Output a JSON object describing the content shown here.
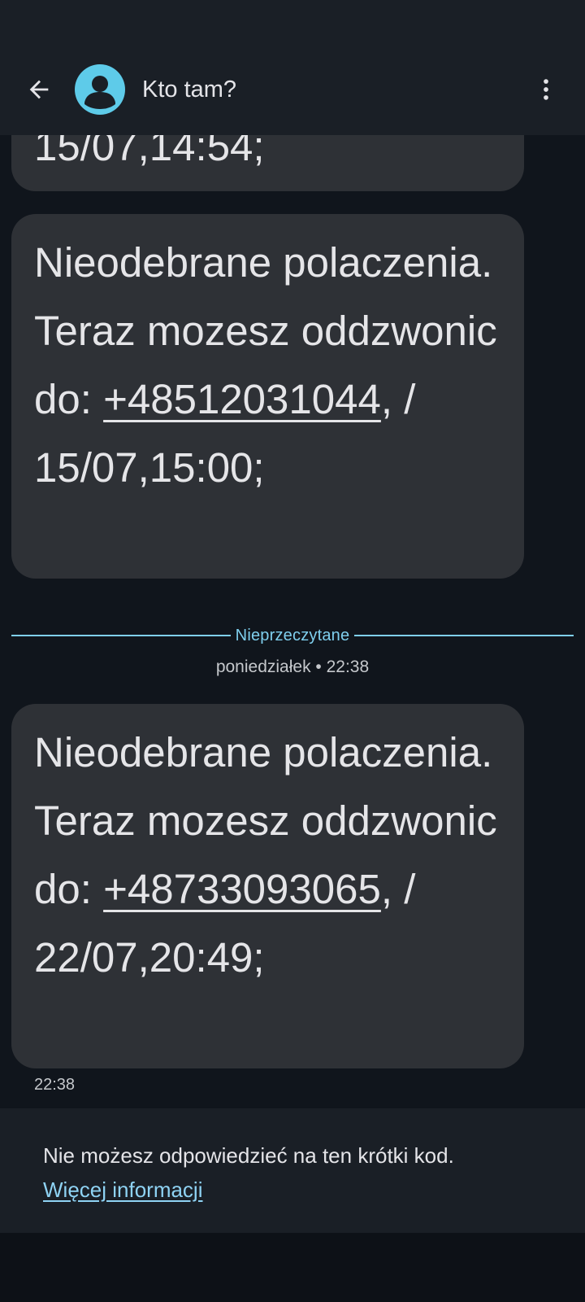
{
  "header": {
    "contact_name": "Kto tam?",
    "back_icon": "arrow-left-icon",
    "avatar_icon": "person-icon",
    "menu_icon": "more-vert-icon"
  },
  "messages": [
    {
      "lines_partial": "15/07,14:54;"
    },
    {
      "text_before": "Nieodebrane polaczenia. Teraz mozesz oddzwonic do: ",
      "phone": "+48512031044",
      "text_after": ", / 15/07,15:00;"
    },
    {
      "text_before": "Nieodebrane polaczenia. Teraz mozesz oddzwonic do: ",
      "phone": "+48733093065",
      "text_after": ", / 22/07,20:49;",
      "time": "22:38"
    }
  ],
  "divider": {
    "unread_label": "Nieprzeczytane",
    "date_label": "poniedziałek • 22:38"
  },
  "footer": {
    "notice": "Nie możesz odpowiedzieć na ten krótki kod.",
    "link_label": "Więcej informacji"
  },
  "colors": {
    "background": "#10151c",
    "bar": "#1a1f26",
    "bubble": "#2e3136",
    "accent": "#7fcfee",
    "avatar": "#5ecbe9"
  }
}
